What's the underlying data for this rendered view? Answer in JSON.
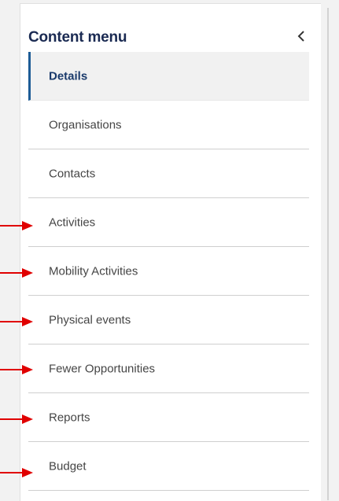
{
  "menu": {
    "title": "Content menu",
    "collapse_icon": "chevron-left-icon",
    "items": [
      {
        "label": "Details",
        "active": true
      },
      {
        "label": "Organisations",
        "active": false
      },
      {
        "label": "Contacts",
        "active": false
      },
      {
        "label": "Activities",
        "active": false
      },
      {
        "label": "Mobility Activities",
        "active": false
      },
      {
        "label": "Physical events",
        "active": false
      },
      {
        "label": "Fewer Opportunities",
        "active": false
      },
      {
        "label": "Reports",
        "active": false
      },
      {
        "label": "Budget",
        "active": false
      }
    ]
  },
  "annotations": {
    "arrow_icon": "arrow-right-icon",
    "arrow_color": "#e00000",
    "highlighted_items": [
      "Activities",
      "Mobility Activities",
      "Physical events",
      "Fewer Opportunities",
      "Reports",
      "Budget"
    ]
  },
  "colors": {
    "accent": "#1d5c96",
    "title": "#1a2a52",
    "active_bg": "#f1f1f1"
  }
}
